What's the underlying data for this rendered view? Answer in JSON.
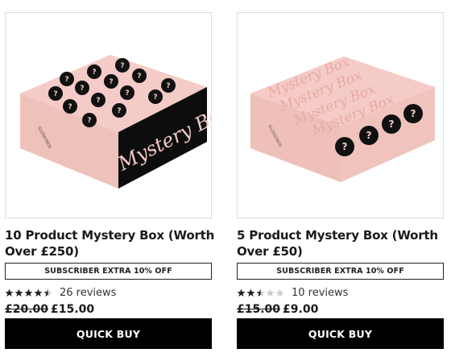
{
  "products": [
    {
      "title": "10 Product Mystery Box (Worth Over £250)",
      "badge": "SUBSCRIBER EXTRA 10% OFF",
      "rating": 4.5,
      "reviews": "26 reviews",
      "rrp": "£20.00",
      "price": "£15.00",
      "button": "QUICK BUY",
      "image_text": "Mystery Box",
      "brand": "GLOSSYBOX"
    },
    {
      "title": "5 Product Mystery Box (Worth Over £50)",
      "badge": "SUBSCRIBER EXTRA 10% OFF",
      "rating": 2.5,
      "reviews": "10 reviews",
      "rrp": "£15.00",
      "price": "£9.00",
      "button": "QUICK BUY",
      "image_text": "Mystery Box",
      "brand": "GLOSSYBOX"
    }
  ],
  "colors": {
    "box_pink": "#f3c9c4",
    "box_pink_dark": "#e9b6b0",
    "black": "#000000",
    "star": "#222222",
    "star_empty": "#cccccc"
  }
}
